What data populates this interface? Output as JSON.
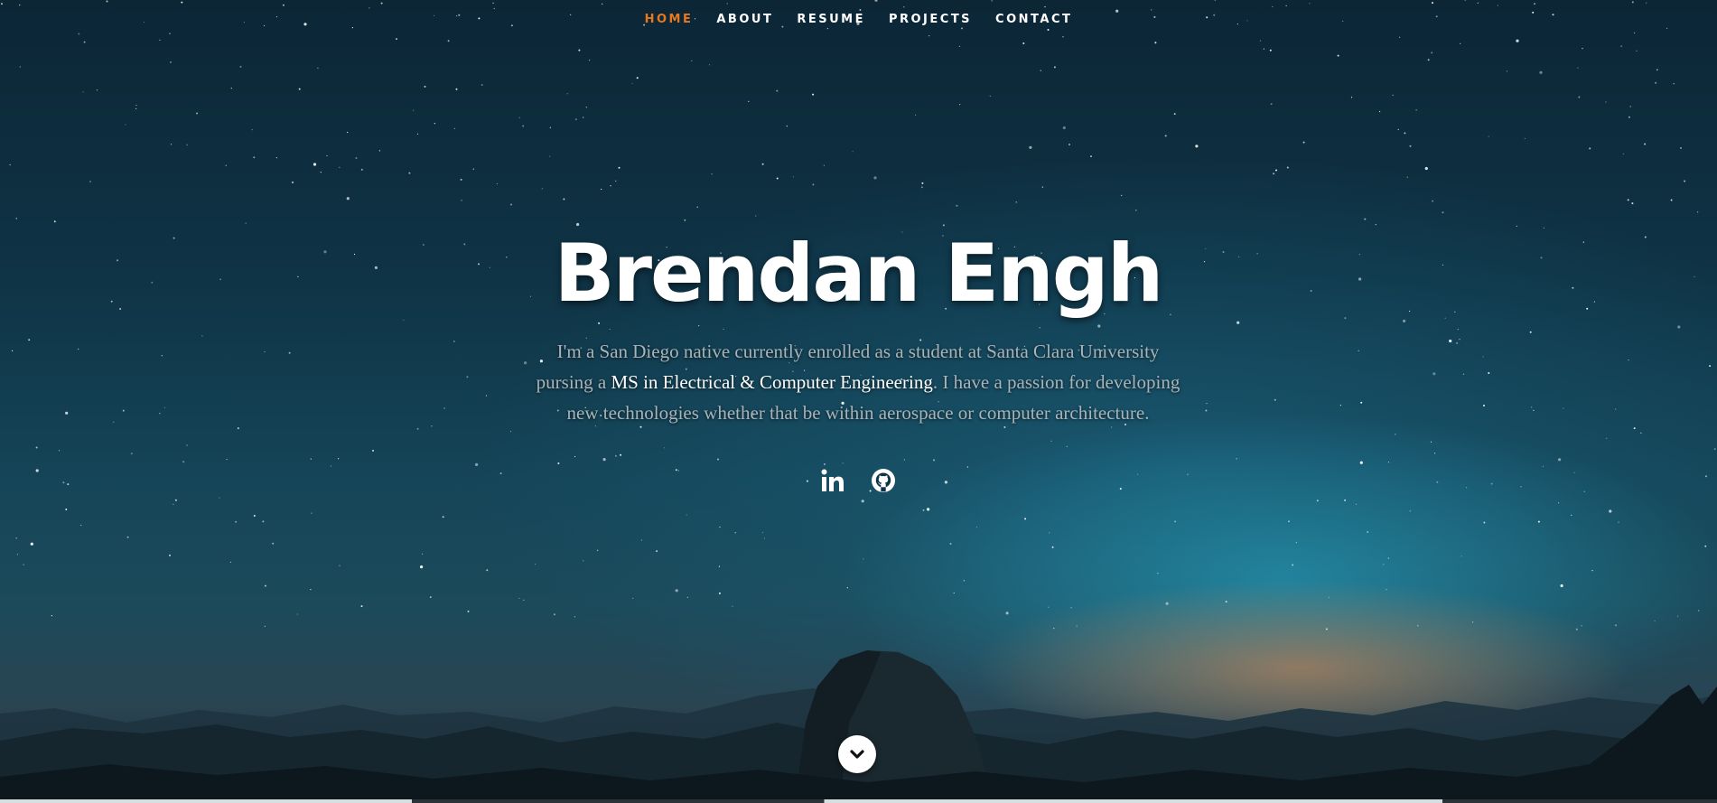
{
  "nav": {
    "items": [
      {
        "label": "HOME",
        "active": true
      },
      {
        "label": "ABOUT",
        "active": false
      },
      {
        "label": "RESUME",
        "active": false
      },
      {
        "label": "PROJECTS",
        "active": false
      },
      {
        "label": "CONTACT",
        "active": false
      }
    ]
  },
  "hero": {
    "name": "Brendan Engh",
    "bio_before": "I'm a San Diego native currently enrolled as a student at Santa Clara University pursing a ",
    "bio_highlight": "MS in Electrical & Computer Engineering",
    "bio_after": ". I have a passion for developing new technologies whether that be within aerospace or computer architecture."
  },
  "social": [
    {
      "icon": "linkedin-icon"
    },
    {
      "icon": "github-icon"
    }
  ],
  "scroll": {
    "icon": "chevron-down-icon"
  },
  "colors": {
    "accent": "#e8781e",
    "text": "#ffffff",
    "bio_text": "#a7b4ba"
  }
}
